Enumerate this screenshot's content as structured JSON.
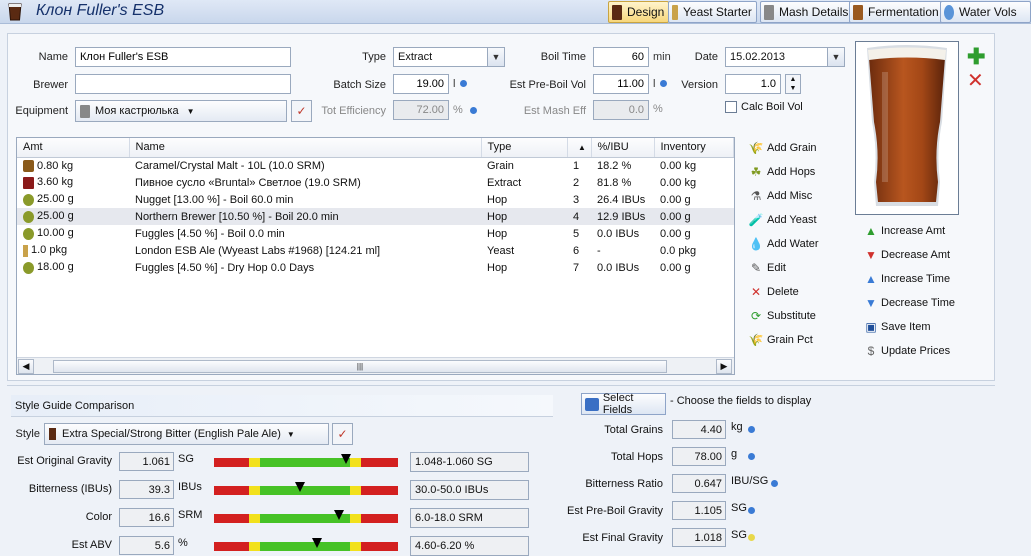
{
  "window": {
    "title": "Клон Fuller's ESB"
  },
  "tabs": [
    {
      "label": "Design",
      "active": true
    },
    {
      "label": "Yeast Starter",
      "active": false
    },
    {
      "label": "Mash Details",
      "active": false
    },
    {
      "label": "Fermentation",
      "active": false
    },
    {
      "label": "Water Vols",
      "active": false
    }
  ],
  "form": {
    "name_label": "Name",
    "name_value": "Клон Fuller's ESB",
    "brewer_label": "Brewer",
    "brewer_value": "",
    "equipment_label": "Equipment",
    "equipment_value": "Моя кастрюлька",
    "type_label": "Type",
    "type_value": "Extract",
    "batch_label": "Batch Size",
    "batch_value": "19.00",
    "batch_unit": "l",
    "eff_label": "Tot Efficiency",
    "eff_value": "72.00",
    "eff_unit": "%",
    "boil_time_label": "Boil Time",
    "boil_time_value": "60",
    "boil_time_unit": "min",
    "preboil_label": "Est Pre-Boil Vol",
    "preboil_value": "11.00",
    "preboil_unit": "l",
    "mash_eff_label": "Est Mash Eff",
    "mash_eff_value": "0.0",
    "mash_eff_unit": "%",
    "date_label": "Date",
    "date_value": "15.02.2013",
    "version_label": "Version",
    "version_value": "1.0",
    "calc_boil_label": "Calc Boil Vol",
    "calc_boil_checked": false
  },
  "grid": {
    "columns": [
      "Amt",
      "Name",
      "Type",
      "",
      "%/IBU",
      "Inventory"
    ],
    "rows": [
      {
        "amt": "0.80 kg",
        "name": "Caramel/Crystal Malt - 10L (10.0 SRM)",
        "type": "Grain",
        "num": "1",
        "pct": "18.2 %",
        "inv": "0.00 kg",
        "icon": "grain-icon"
      },
      {
        "amt": "3.60 kg",
        "name": "Пивное сусло «Bruntal» Светлое (19.0 SRM)",
        "type": "Extract",
        "num": "2",
        "pct": "81.8 %",
        "inv": "0.00 kg",
        "icon": "extract-icon"
      },
      {
        "amt": "25.00 g",
        "name": "Nugget [13.00 %] - Boil 60.0 min",
        "type": "Hop",
        "num": "3",
        "pct": "26.4 IBUs",
        "inv": "0.00 g",
        "icon": "hop-icon"
      },
      {
        "amt": "25.00 g",
        "name": "Northern Brewer [10.50 %] - Boil 20.0 min",
        "type": "Hop",
        "num": "4",
        "pct": "12.9 IBUs",
        "inv": "0.00 g",
        "icon": "hop-icon",
        "selected": true
      },
      {
        "amt": "10.00 g",
        "name": "Fuggles [4.50 %] - Boil 0.0 min",
        "type": "Hop",
        "num": "5",
        "pct": "0.0 IBUs",
        "inv": "0.00 g",
        "icon": "hop-icon"
      },
      {
        "amt": "1.0 pkg",
        "name": "London ESB Ale (Wyeast Labs #1968) [124.21 ml]",
        "type": "Yeast",
        "num": "6",
        "pct": "-",
        "inv": "0.0 pkg",
        "icon": "yeast-icon"
      },
      {
        "amt": "18.00 g",
        "name": "Fuggles [4.50 %] - Dry Hop 0.0 Days",
        "type": "Hop",
        "num": "7",
        "pct": "0.0 IBUs",
        "inv": "0.00 g",
        "icon": "hop-icon"
      }
    ]
  },
  "actions": [
    "Add Grain",
    "Add Hops",
    "Add Misc",
    "Add Yeast",
    "Add Water",
    "Edit",
    "Delete",
    "Substitute",
    "Grain Pct"
  ],
  "right_actions": [
    "Increase Amt",
    "Decrease Amt",
    "Increase Time",
    "Decrease Time",
    "Save Item",
    "Update Prices"
  ],
  "style": {
    "section_title": "Style Guide Comparison",
    "style_label": "Style",
    "style_value": "Extra Special/Strong Bitter (English Pale Ale)",
    "rows": [
      {
        "label": "Est Original Gravity",
        "value": "1.061",
        "unit": "SG",
        "range": "1.048-1.060 SG",
        "marker_pct": 0.72
      },
      {
        "label": "Bitterness (IBUs)",
        "value": "39.3",
        "unit": "IBUs",
        "range": "30.0-50.0 IBUs",
        "marker_pct": 0.47
      },
      {
        "label": "Color",
        "value": "16.6",
        "unit": "SRM",
        "range": "6.0-18.0 SRM",
        "marker_pct": 0.68
      },
      {
        "label": "Est ABV",
        "value": "5.6",
        "unit": "%",
        "range": "4.60-6.20 %",
        "marker_pct": 0.56
      }
    ]
  },
  "props": {
    "select_fields_label": "Select Fields",
    "select_fields_hint": "- Choose the fields to display",
    "rows": [
      {
        "label": "Total Grains",
        "value": "4.40",
        "unit": "kg",
        "dot": "#3a7bd5"
      },
      {
        "label": "Total Hops",
        "value": "78.00",
        "unit": "g",
        "dot": "#3a7bd5"
      },
      {
        "label": "Bitterness Ratio",
        "value": "0.647",
        "unit": "IBU/SG",
        "dot": "#3a7bd5"
      },
      {
        "label": "Est Pre-Boil Gravity",
        "value": "1.105",
        "unit": "SG",
        "dot": "#3a7bd5"
      },
      {
        "label": "Est Final Gravity",
        "value": "1.018",
        "unit": "SG",
        "dot": "#e8d84a"
      }
    ]
  },
  "colors": {
    "beer": "#a14a1c",
    "accent_green": "#2e9d2e",
    "accent_red": "#d0312d"
  }
}
